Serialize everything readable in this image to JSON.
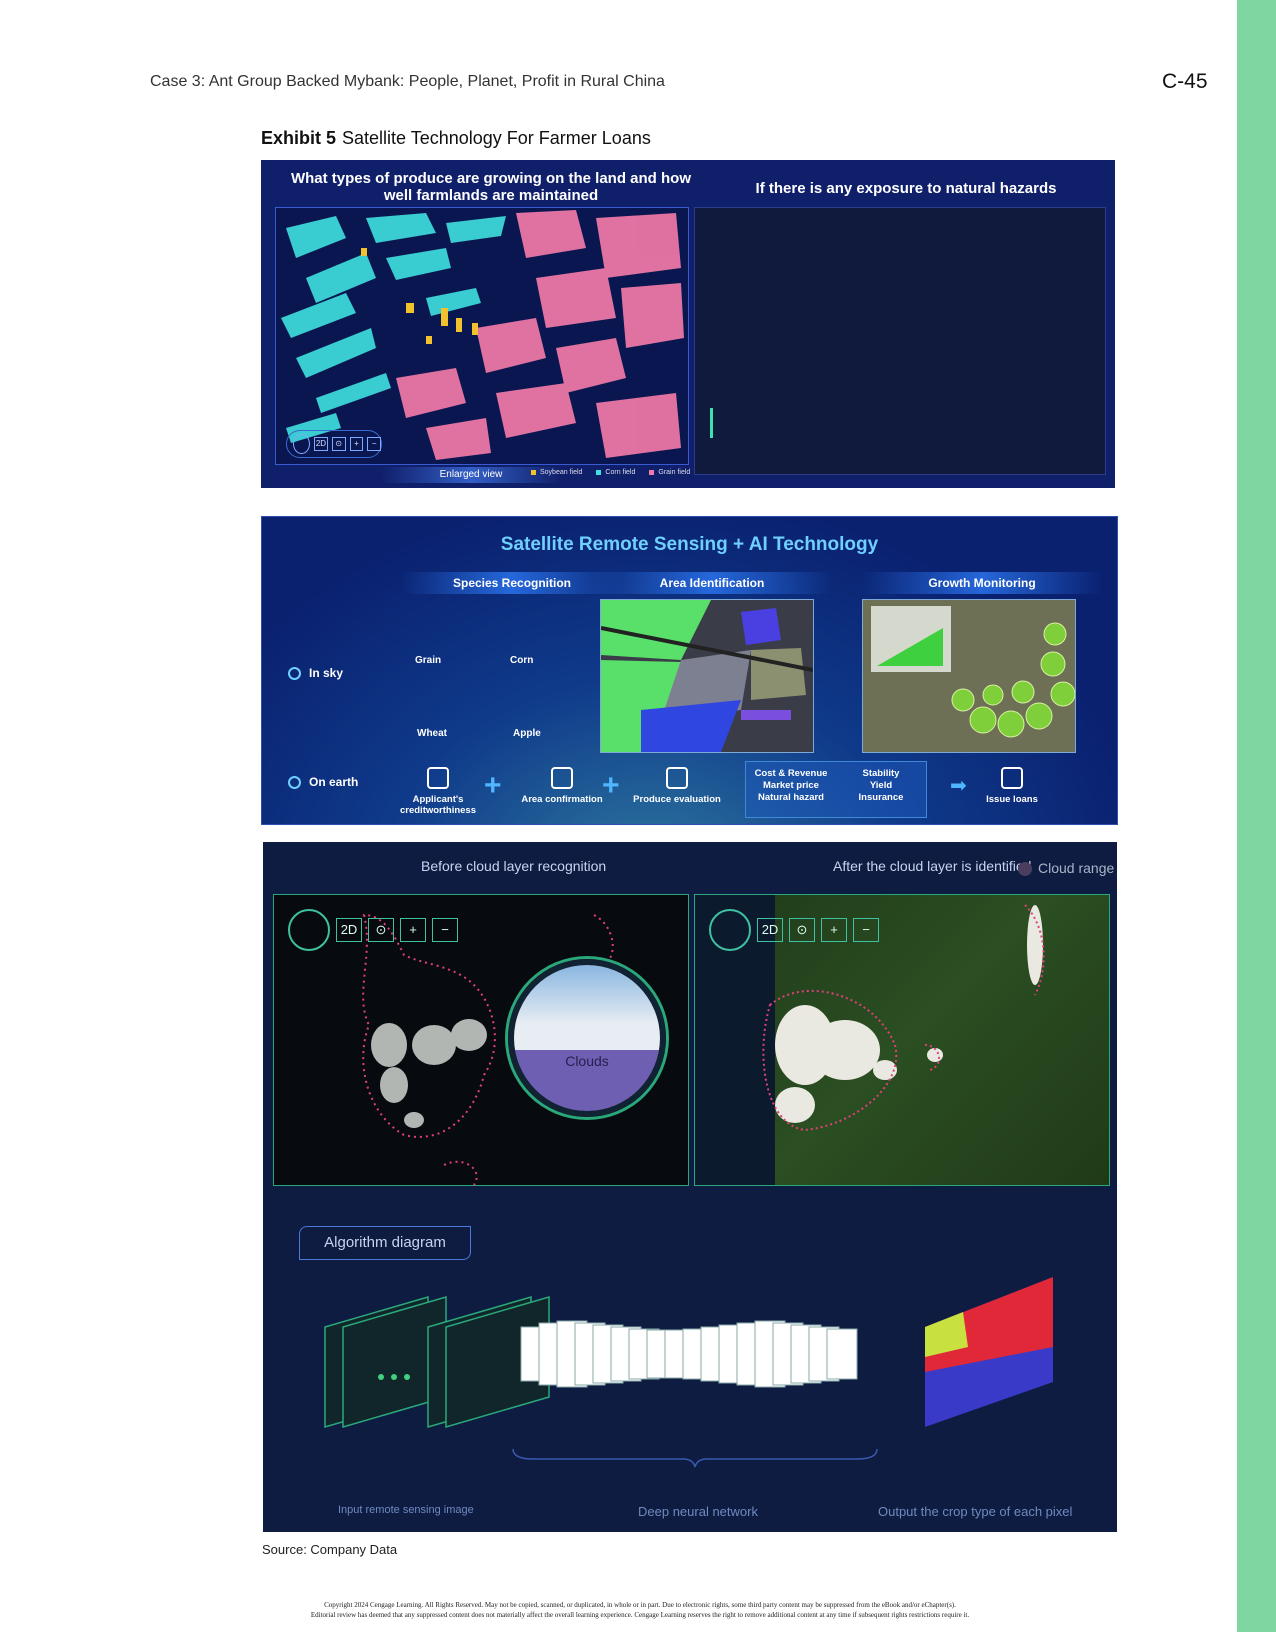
{
  "header": {
    "running_head": "Case 3: Ant Group Backed Mybank: People, Planet, Profit in Rural China",
    "page_number": "C-45"
  },
  "exhibit": {
    "label": "Exhibit 5",
    "title": "Satellite Technology For Farmer Loans"
  },
  "panel1": {
    "left_title": "What types of produce are growing on the land and how well farmlands are maintained",
    "right_title": "If there is any exposure to natural hazards",
    "enlarged_view": "Enlarged view",
    "map_controls": [
      "2D",
      "⊙",
      "+",
      "−"
    ],
    "legend": [
      {
        "label": "Soybean field",
        "color": "#f2c22e"
      },
      {
        "label": "Corn field",
        "color": "#3fe0e0"
      },
      {
        "label": "Grain field",
        "color": "#f27aa8"
      }
    ]
  },
  "panel2": {
    "title": "Satellite Remote Sensing + AI Technology",
    "columns": [
      "Species Recognition",
      "Area Identification",
      "Growth Monitoring"
    ],
    "rows": {
      "sky": "In sky",
      "earth": "On earth"
    },
    "crops": [
      "Grain",
      "Corn",
      "Wheat",
      "Apple"
    ],
    "steps": [
      "Applicant's creditworthiness",
      "Area confirmation",
      "Produce evaluation"
    ],
    "cost_box": {
      "left": [
        "Cost & Revenue",
        "Market price",
        "Natural hazard"
      ],
      "right": [
        "Stability",
        "Yield",
        "Insurance"
      ]
    },
    "final_step": "Issue loans"
  },
  "panel3": {
    "before_caption": "Before cloud layer recognition",
    "after_caption": "After the cloud layer is identified",
    "legend": "Cloud range",
    "bubble_label": "Clouds",
    "map_controls": [
      "2D",
      "⊙",
      "+",
      "−"
    ],
    "algorithm_label": "Algorithm diagram",
    "bottom_labels": [
      "Input remote sensing image",
      "Deep neural network",
      "Output the crop type of each pixel"
    ]
  },
  "source": "Source: Company Data",
  "copyright": [
    "Copyright 2024 Cengage Learning. All Rights Reserved. May not be copied, scanned, or duplicated, in whole or in part. Due to electronic rights, some third party content may be suppressed from the eBook and/or eChapter(s).",
    "Editorial review has deemed that any suppressed content does not materially affect the overall learning experience. Cengage Learning reserves the right to remove additional content at any time if subsequent rights restrictions require it."
  ]
}
